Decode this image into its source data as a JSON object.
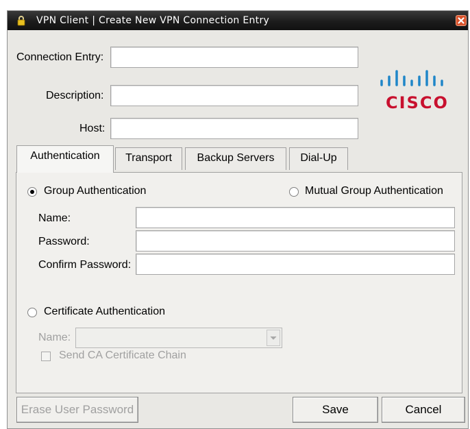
{
  "window": {
    "title": "VPN Client  |  Create New VPN Connection Entry"
  },
  "header": {
    "connection_entry_label": "Connection Entry:",
    "description_label": "Description:",
    "host_label": "Host:",
    "connection_entry_value": "",
    "description_value": "",
    "host_value": "",
    "logo_text": "CISCO"
  },
  "tabs": [
    "Authentication",
    "Transport",
    "Backup Servers",
    "Dial-Up"
  ],
  "auth": {
    "group_auth_label": "Group Authentication",
    "mutual_auth_label": "Mutual Group Authentication",
    "name_label": "Name:",
    "password_label": "Password:",
    "confirm_password_label": "Confirm Password:",
    "certificate_auth_label": "Certificate Authentication",
    "cert_name_label": "Name:",
    "send_ca_label": "Send CA Certificate Chain",
    "selected": "Group Authentication"
  },
  "buttons": {
    "erase": "Erase User Password",
    "save": "Save",
    "cancel": "Cancel"
  },
  "colors": {
    "logo_red": "#c8102e",
    "logo_blue": "#1f86c8"
  }
}
